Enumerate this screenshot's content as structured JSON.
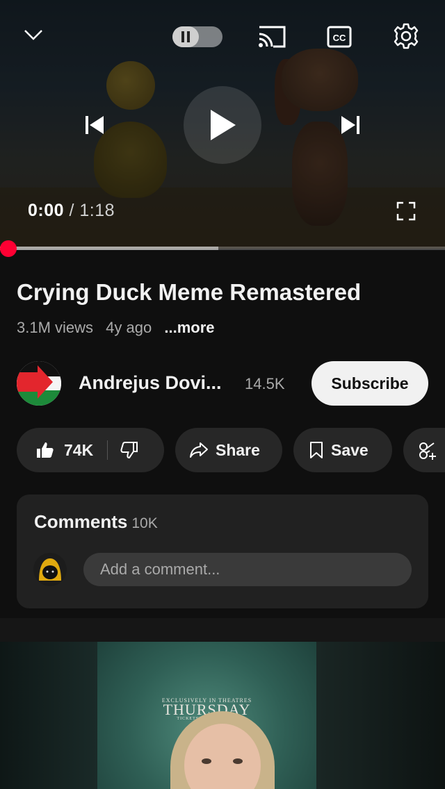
{
  "player": {
    "current_time": "0:00",
    "separator": "/",
    "duration": "1:18",
    "played_fraction": 0.0,
    "buffered_fraction": 0.49,
    "autoplay": "on",
    "cc_label": "CC"
  },
  "video": {
    "title": "Crying Duck Meme Remastered",
    "views": "3.1M views",
    "age": "4y ago",
    "more": "...more"
  },
  "channel": {
    "name": "Andrejus Dovi...",
    "subscribers": "14.5K",
    "subscribe_label": "Subscribe"
  },
  "actions": {
    "likes": "74K",
    "share": "Share",
    "save": "Save"
  },
  "comments": {
    "title": "Comments",
    "count": "10K",
    "placeholder": "Add a comment..."
  },
  "next_video": {
    "line1": "EXCLUSIVELY IN THEATRES",
    "line2": "THURSDAY",
    "line3": "TICKETS ON SALE NOW"
  },
  "colors": {
    "background": "#0f0f0f",
    "accent_red": "#ff0033",
    "pill": "#272727"
  }
}
